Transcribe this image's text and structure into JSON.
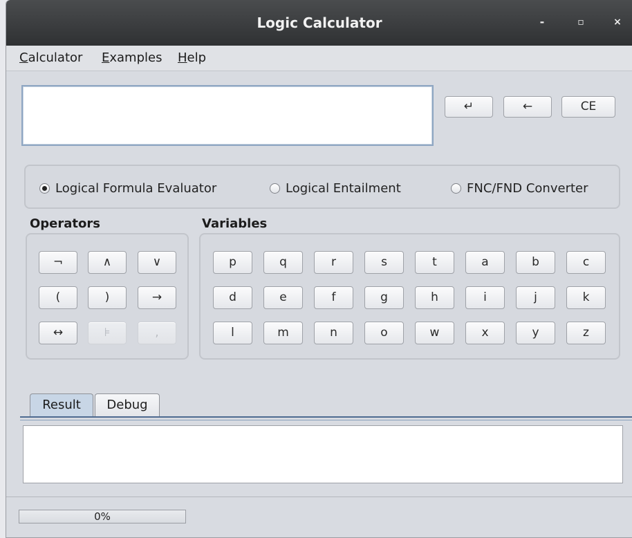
{
  "window": {
    "title": "Logic Calculator",
    "controls": {
      "minimize": "-",
      "maximize": "▫",
      "close": "×"
    }
  },
  "menubar": {
    "items": [
      {
        "mnemonic": "C",
        "rest": "alculator"
      },
      {
        "mnemonic": "E",
        "rest": "xamples"
      },
      {
        "mnemonic": "H",
        "rest": "elp"
      }
    ]
  },
  "formula": {
    "value": ""
  },
  "edit_buttons": {
    "enter": "↵",
    "backspace": "←",
    "clear": "CE"
  },
  "modes": {
    "options": [
      "Logical Formula Evaluator",
      "Logical Entailment",
      "FNC/FND Converter"
    ],
    "selected": "Logical Formula Evaluator"
  },
  "operators": {
    "label": "Operators",
    "buttons": [
      "¬",
      "∧",
      "∨",
      "(",
      ")",
      "→",
      "↔",
      "⊧",
      ","
    ],
    "disabled": [
      "⊧",
      ","
    ]
  },
  "variables": {
    "label": "Variables",
    "buttons": [
      "p",
      "q",
      "r",
      "s",
      "t",
      "a",
      "b",
      "c",
      "d",
      "e",
      "f",
      "g",
      "h",
      "i",
      "j",
      "k",
      "l",
      "m",
      "n",
      "o",
      "w",
      "x",
      "y",
      "z"
    ]
  },
  "tabs": {
    "items": [
      "Result",
      "Debug"
    ],
    "active": "Result"
  },
  "result": {
    "value": ""
  },
  "status": {
    "progress_label": "0%",
    "progress_fraction": 0.0
  }
}
